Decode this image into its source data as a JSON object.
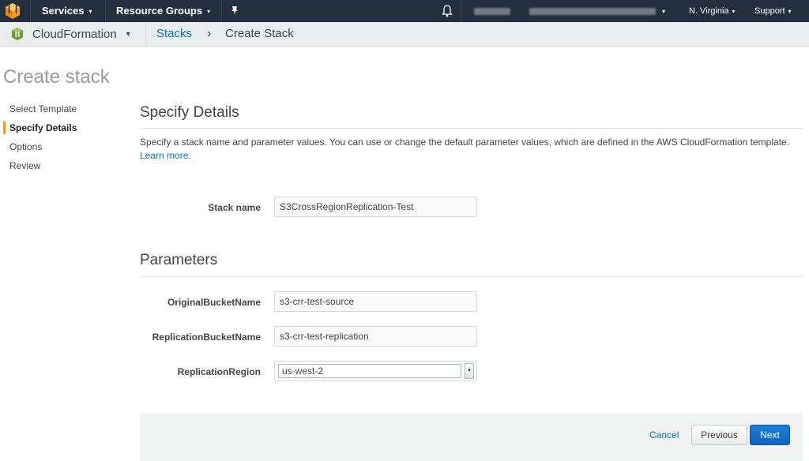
{
  "topnav": {
    "services_label": "Services",
    "resource_groups_label": "Resource Groups",
    "region_label": "N. Virginia",
    "support_label": "Support",
    "caret": "▾",
    "icons": [
      "aws-logo-icon",
      "pin-icon",
      "bell-icon"
    ]
  },
  "subnav": {
    "service_name": "CloudFormation",
    "crumb_stacks": "Stacks",
    "crumb_sep": "›",
    "crumb_current": "Create Stack"
  },
  "page": {
    "title": "Create stack"
  },
  "steps": [
    {
      "label": "Select Template",
      "active": false
    },
    {
      "label": "Specify Details",
      "active": true
    },
    {
      "label": "Options",
      "active": false
    },
    {
      "label": "Review",
      "active": false
    }
  ],
  "details": {
    "heading": "Specify Details",
    "description": "Specify a stack name and parameter values. You can use or change the default parameter values, which are defined in the AWS CloudFormation template.",
    "learn_more": "Learn more.",
    "stack_name_label": "Stack name",
    "stack_name_value": "S3CrossRegionReplication-Test"
  },
  "parameters": {
    "heading": "Parameters",
    "original_label": "OriginalBucketName",
    "original_value": "s3-crr-test-source",
    "replication_label": "ReplicationBucketName",
    "replication_value": "s3-crr-test-replication",
    "region_label": "ReplicationRegion",
    "region_value": "us-west-2"
  },
  "footer": {
    "cancel": "Cancel",
    "previous": "Previous",
    "next": "Next"
  },
  "colors": {
    "nav_bg": "#232f3e",
    "subnav_bg": "#eaeded",
    "link": "#0073bb",
    "accent": "#ff9900",
    "primary_button": "#0a64c2"
  }
}
